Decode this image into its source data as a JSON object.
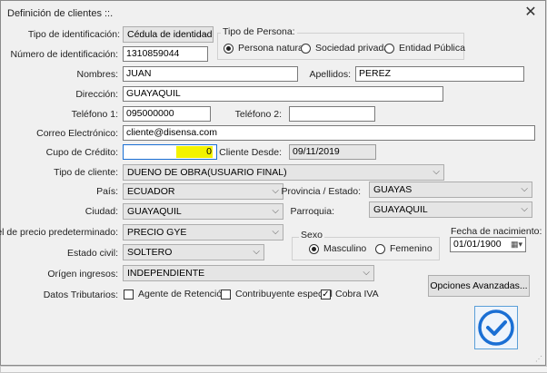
{
  "window": {
    "title": "Definición de clientes ::.",
    "close_glyph": "✕"
  },
  "form": {
    "tipo_identificacion": {
      "label": "Tipo de identificación:",
      "value": "Cédula de identidad"
    },
    "numero_identificacion": {
      "label": "Número de identificación:",
      "value": "1310859044"
    },
    "tipo_persona": {
      "title": "Tipo de Persona:",
      "options": [
        "Persona natural",
        "Sociedad privada",
        "Entidad Pública"
      ],
      "selected": "Persona natural"
    },
    "nombres": {
      "label": "Nombres:",
      "value": "JUAN"
    },
    "apellidos": {
      "label": "Apellidos:",
      "value": "PEREZ"
    },
    "direccion": {
      "label": "Dirección:",
      "value": "GUAYAQUIL"
    },
    "telefono1": {
      "label": "Teléfono 1:",
      "value": "095000000"
    },
    "telefono2": {
      "label": "Teléfono 2:",
      "value": ""
    },
    "correo": {
      "label": "Correo Electrónico:",
      "value": "cliente@disensa.com"
    },
    "cupo_credito": {
      "label": "Cupo de Crédito:",
      "value": "0"
    },
    "cliente_desde": {
      "label": "Cliente Desde:",
      "value": "09/11/2019"
    },
    "tipo_cliente": {
      "label": "Tipo de cliente:",
      "value": "DUENO DE OBRA(USUARIO FINAL)"
    },
    "pais": {
      "label": "País:",
      "value": "ECUADOR"
    },
    "provincia": {
      "label": "Provincia / Estado:",
      "value": "GUAYAS"
    },
    "ciudad": {
      "label": "Ciudad:",
      "value": "GUAYAQUIL"
    },
    "parroquia": {
      "label": "Parroquia:",
      "value": "GUAYAQUIL"
    },
    "nivel_precio": {
      "label": "Nivel de precio predeterminado:",
      "value": "PRECIO GYE"
    },
    "sexo": {
      "title": "Sexo",
      "options": [
        "Masculino",
        "Femenino"
      ],
      "selected": "Masculino"
    },
    "fecha_nacimiento": {
      "label": "Fecha de nacimiento:",
      "value": "01/01/1900"
    },
    "estado_civil": {
      "label": "Estado civil:",
      "value": "SOLTERO"
    },
    "origen_ingresos": {
      "label": "Orígen ingresos:",
      "value": "INDEPENDIENTE"
    },
    "datos_tributarios": {
      "label": "Datos Tributarios:",
      "options": [
        {
          "label": "Agente de Retención",
          "checked": false
        },
        {
          "label": "Contribuyente especial",
          "checked": false
        },
        {
          "label": "Cobra IVA",
          "checked": true
        }
      ]
    },
    "opciones_avanzadas": "Opciones Avanzadas...",
    "accept_icon": "checkmark-circle-icon"
  },
  "colors": {
    "accent": "#1a6fd4",
    "highlight": "#f3f300"
  }
}
